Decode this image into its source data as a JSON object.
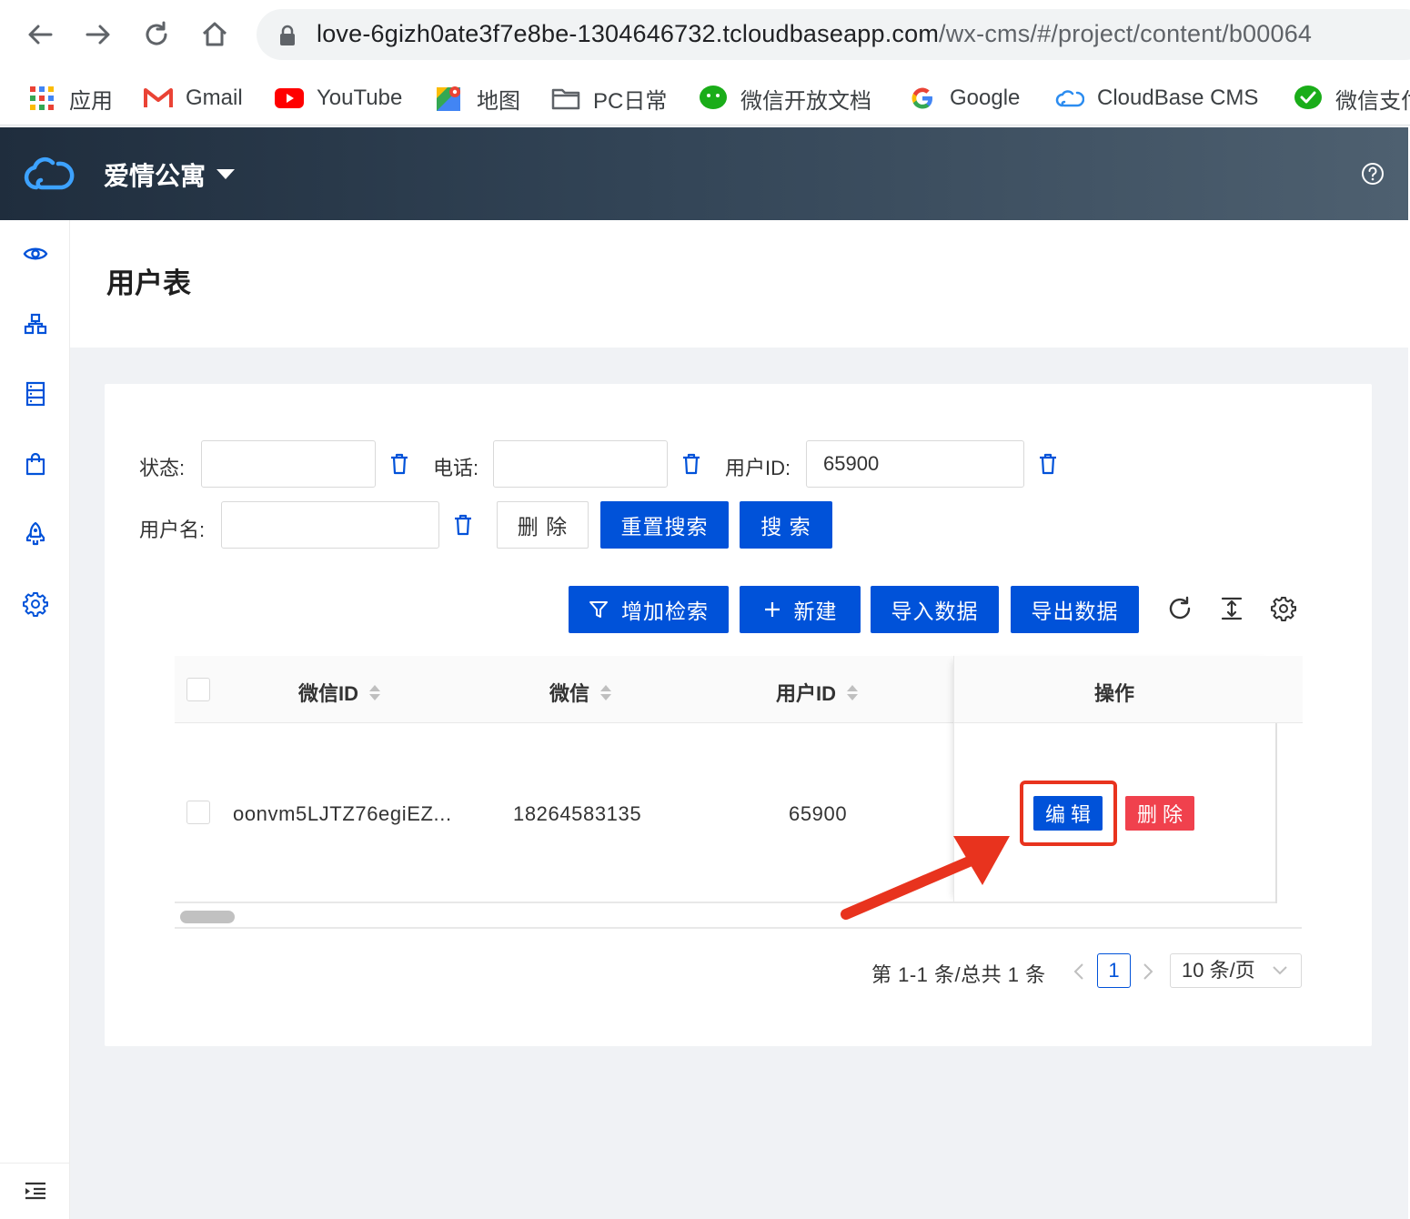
{
  "browser": {
    "url_host": "love-6gizh0ate3f7e8be-1304646732.tcloudbaseapp.com",
    "url_path": "/wx-cms/#/project/content/b00064",
    "bookmarks": [
      {
        "label": "应用",
        "icon": "apps-grid-icon"
      },
      {
        "label": "Gmail",
        "icon": "gmail-icon"
      },
      {
        "label": "YouTube",
        "icon": "youtube-icon"
      },
      {
        "label": "地图",
        "icon": "maps-icon"
      },
      {
        "label": "PC日常",
        "icon": "folder-icon"
      },
      {
        "label": "微信开放文档",
        "icon": "wechat-icon"
      },
      {
        "label": "Google",
        "icon": "google-icon"
      },
      {
        "label": "CloudBase CMS",
        "icon": "cloudbase-icon"
      },
      {
        "label": "微信支付",
        "icon": "wechat-pay-icon"
      }
    ]
  },
  "header": {
    "project_name": "爱情公寓"
  },
  "sidebar": {
    "items": [
      "eye-icon",
      "sitemap-icon",
      "database-icon",
      "shopping-bag-icon",
      "rocket-icon",
      "gear-icon"
    ],
    "bottom": "menu-fold-icon"
  },
  "page": {
    "title": "用户表"
  },
  "filters": {
    "status_label": "状态:",
    "status_value": "",
    "phone_label": "电话:",
    "phone_value": "",
    "userid_label": "用户ID:",
    "userid_value": "65900",
    "username_label": "用户名:",
    "username_value": "",
    "delete_label": "删 除",
    "reset_label": "重置搜索",
    "search_label": "搜 索"
  },
  "toolbar": {
    "add_filter_label": "增加检索",
    "new_label": "新建",
    "import_label": "导入数据",
    "export_label": "导出数据"
  },
  "table": {
    "columns": [
      "微信ID",
      "微信",
      "用户ID",
      "操作"
    ],
    "rows": [
      {
        "wechat_id": "oonvm5LJTZ76egiEZ...",
        "wechat": "18264583135",
        "user_id": "65900"
      }
    ],
    "edit_label": "编辑",
    "delete_label": "删除",
    "edit_color": "#0052d9",
    "delete_color": "#f0414d",
    "highlight_color": "#e8331e"
  },
  "pagination": {
    "summary": "第 1-1 条/总共 1 条",
    "current_page": "1",
    "page_size": "10 条/页"
  }
}
